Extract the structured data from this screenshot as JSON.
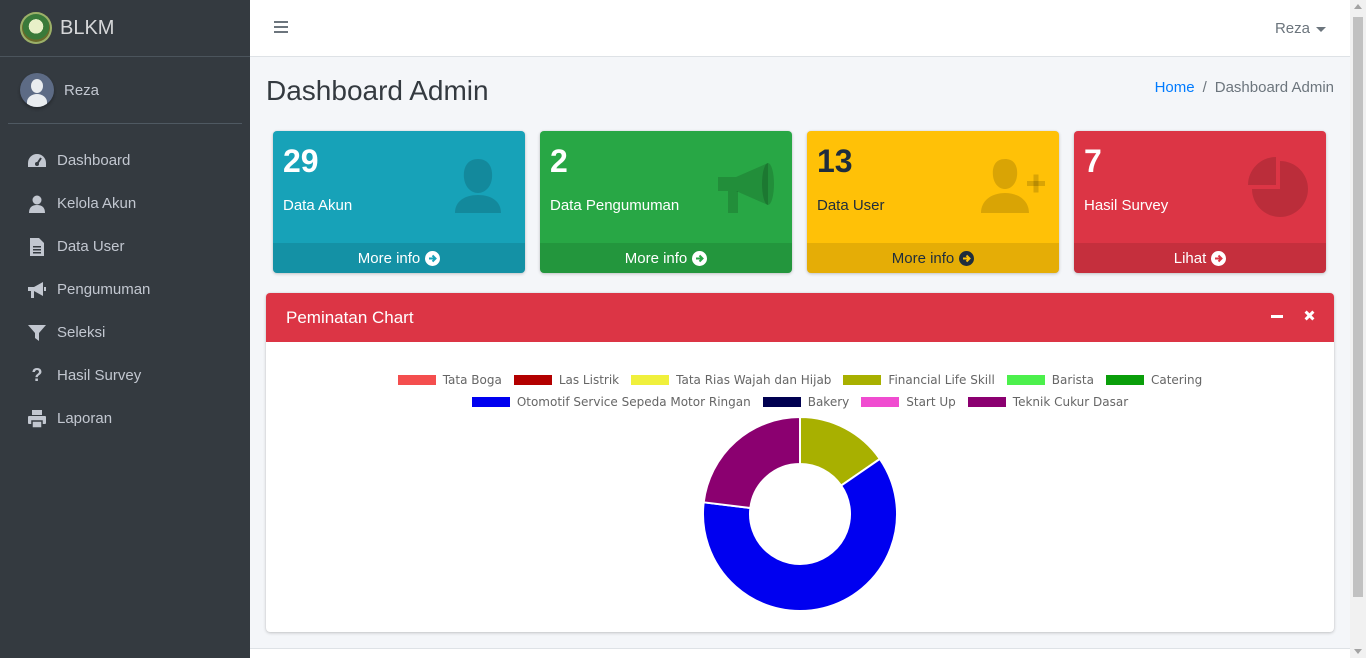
{
  "brand": {
    "name": "BLKM"
  },
  "user": {
    "name": "Reza"
  },
  "sidebar": {
    "items": [
      {
        "label": "Dashboard",
        "icon": "tachometer-icon"
      },
      {
        "label": "Kelola Akun",
        "icon": "user-icon"
      },
      {
        "label": "Data User",
        "icon": "file-icon"
      },
      {
        "label": "Pengumuman",
        "icon": "bullhorn-icon"
      },
      {
        "label": "Seleksi",
        "icon": "filter-icon"
      },
      {
        "label": "Hasil Survey",
        "icon": "question-icon"
      },
      {
        "label": "Laporan",
        "icon": "print-icon"
      }
    ]
  },
  "navbar": {
    "user_label": "Reza"
  },
  "header": {
    "title": "Dashboard Admin"
  },
  "breadcrumb": {
    "home": "Home",
    "separator": "/",
    "current": "Dashboard Admin"
  },
  "boxes": [
    {
      "number": "29",
      "label": "Data Akun",
      "footer": "More info",
      "color": "#17a2b8",
      "icon": "user-icon"
    },
    {
      "number": "2",
      "label": "Data Pengumuman",
      "footer": "More info",
      "color": "#28a745",
      "icon": "bullhorn-icon"
    },
    {
      "number": "13",
      "label": "Data User",
      "footer": "More info",
      "color": "#ffc107",
      "icon": "user-plus-icon"
    },
    {
      "number": "7",
      "label": "Hasil Survey",
      "footer": "Lihat",
      "color": "#dc3545",
      "icon": "pie-chart-icon"
    }
  ],
  "card": {
    "title": "Peminatan Chart",
    "header_color": "#dc3545"
  },
  "chart_data": {
    "type": "pie",
    "donut": true,
    "legend_position": "top",
    "categories": [
      "Tata Boga",
      "Las Listrik",
      "Tata Rias Wajah dan Hijab",
      "Financial Life Skill",
      "Barista",
      "Catering",
      "Otomotif Service Sepeda Motor Ringan",
      "Bakery",
      "Start Up",
      "Teknik Cukur Dasar"
    ],
    "colors": [
      "#f44e4e",
      "#b30000",
      "#f0f03c",
      "#a8b000",
      "#4cf04c",
      "#0a9e0a",
      "#0000f0",
      "#000050",
      "#f04cd0",
      "#8b0070"
    ],
    "values": [
      0,
      0,
      0,
      1,
      0,
      0,
      4,
      0,
      0,
      1.5
    ]
  }
}
